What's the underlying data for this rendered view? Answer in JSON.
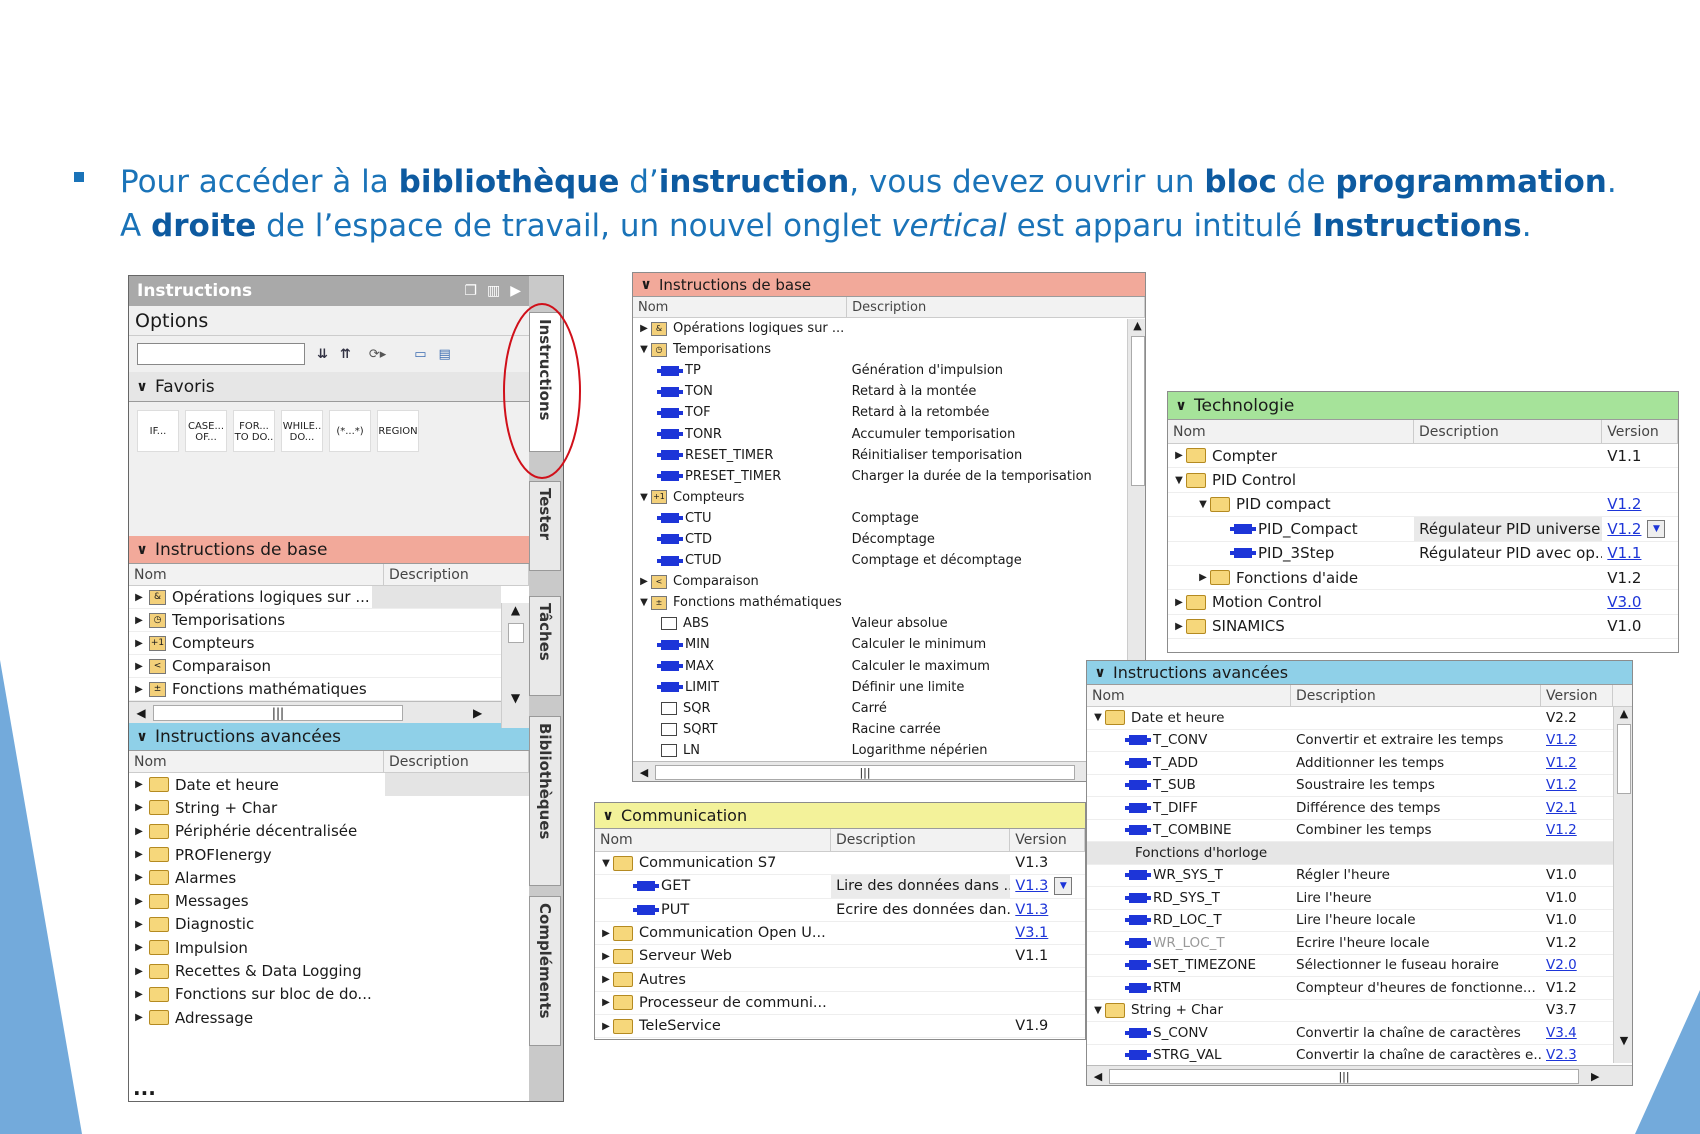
{
  "intro": {
    "line1_parts": [
      "Pour accéder à la ",
      "bibliothèque",
      " d’",
      "instruction",
      ", vous devez ouvrir un ",
      "bloc",
      " de ",
      "programmation",
      "."
    ],
    "line2_parts": [
      "A ",
      "droite",
      " de l’espace de travail, un nouvel onglet ",
      "vertical",
      " est apparu intitulé ",
      "Instructions",
      "."
    ]
  },
  "left_panel": {
    "title": "Instructions",
    "options": "Options",
    "favoris": "Favoris",
    "favorites": [
      "IF...",
      "CASE... OF...",
      "FOR... TO DO..",
      "WHILE.. DO...",
      "(*...*)",
      "REGION"
    ],
    "base": {
      "title": "Instructions de base",
      "col_name": "Nom",
      "col_desc": "Description",
      "items": [
        "Opérations logiques sur ...",
        "Temporisations",
        "Compteurs",
        "Comparaison",
        "Fonctions mathématiques"
      ]
    },
    "advanced": {
      "title": "Instructions avancées",
      "col_name": "Nom",
      "col_desc": "Description",
      "items": [
        "Date et heure",
        "String + Char",
        "Périphérie décentralisée",
        "PROFIenergy",
        "Alarmes",
        "Messages",
        "Diagnostic",
        "Impulsion",
        "Recettes & Data Logging",
        "Fonctions sur bloc de do...",
        "Adressage"
      ]
    },
    "ellipsis": "...",
    "vertical_tabs": [
      "Instructions",
      "Tester",
      "Tâches",
      "Bibliothèques",
      "Compléments"
    ]
  },
  "base_panel": {
    "title": "Instructions de base",
    "col_name": "Nom",
    "col_desc": "Description",
    "rows": [
      {
        "name": "Opérations logiques sur ...",
        "desc": ""
      },
      {
        "name": "Temporisations",
        "desc": ""
      },
      {
        "name": "TP",
        "desc": "Génération d'impulsion"
      },
      {
        "name": "TON",
        "desc": "Retard à la montée"
      },
      {
        "name": "TOF",
        "desc": "Retard à la retombée"
      },
      {
        "name": "TONR",
        "desc": "Accumuler temporisation"
      },
      {
        "name": "RESET_TIMER",
        "desc": "Réinitialiser temporisation"
      },
      {
        "name": "PRESET_TIMER",
        "desc": "Charger la durée de la temporisation"
      },
      {
        "name": "Compteurs",
        "desc": ""
      },
      {
        "name": "CTU",
        "desc": "Comptage"
      },
      {
        "name": "CTD",
        "desc": "Décomptage"
      },
      {
        "name": "CTUD",
        "desc": "Comptage et décomptage"
      },
      {
        "name": "Comparaison",
        "desc": ""
      },
      {
        "name": "Fonctions mathématiques",
        "desc": ""
      },
      {
        "name": "ABS",
        "desc": "Valeur absolue"
      },
      {
        "name": "MIN",
        "desc": "Calculer le minimum"
      },
      {
        "name": "MAX",
        "desc": "Calculer le maximum"
      },
      {
        "name": "LIMIT",
        "desc": "Définir une limite"
      },
      {
        "name": "SQR",
        "desc": "Carré"
      },
      {
        "name": "SQRT",
        "desc": "Racine carrée"
      },
      {
        "name": "LN",
        "desc": "Logarithme népérien"
      }
    ]
  },
  "tech_panel": {
    "title": "Technologie",
    "col_name": "Nom",
    "col_desc": "Description",
    "col_ver": "Version",
    "rows": [
      {
        "name": "Compter",
        "desc": "",
        "ver": "V1.1"
      },
      {
        "name": "PID Control",
        "desc": "",
        "ver": ""
      },
      {
        "name": "PID compact",
        "desc": "",
        "ver": "V1.2"
      },
      {
        "name": "PID_Compact",
        "desc": "Régulateur PID universe...",
        "ver": "V1.2"
      },
      {
        "name": "PID_3Step",
        "desc": "Régulateur PID avec op...",
        "ver": "V1.1"
      },
      {
        "name": "Fonctions d'aide",
        "desc": "",
        "ver": "V1.2"
      },
      {
        "name": "Motion Control",
        "desc": "",
        "ver": "V3.0"
      },
      {
        "name": "SINAMICS",
        "desc": "",
        "ver": "V1.0"
      }
    ]
  },
  "comm_panel": {
    "title": "Communication",
    "col_name": "Nom",
    "col_desc": "Description",
    "col_ver": "Version",
    "rows": [
      {
        "name": "Communication S7",
        "desc": "",
        "ver": "V1.3"
      },
      {
        "name": "GET",
        "desc": "Lire des données dans ...",
        "ver": "V1.3"
      },
      {
        "name": "PUT",
        "desc": "Ecrire des données dan...",
        "ver": "V1.3"
      },
      {
        "name": "Communication Open U...",
        "desc": "",
        "ver": "V3.1"
      },
      {
        "name": "Serveur Web",
        "desc": "",
        "ver": "V1.1"
      },
      {
        "name": "Autres",
        "desc": "",
        "ver": ""
      },
      {
        "name": "Processeur de communi...",
        "desc": "",
        "ver": ""
      },
      {
        "name": "TeleService",
        "desc": "",
        "ver": "V1.9"
      }
    ]
  },
  "adv_panel": {
    "title": "Instructions avancées",
    "col_name": "Nom",
    "col_desc": "Description",
    "col_ver": "Version",
    "rows": [
      {
        "name": "Date et heure",
        "desc": "",
        "ver": "V2.2"
      },
      {
        "name": "T_CONV",
        "desc": "Convertir et extraire les temps",
        "ver": "V1.2"
      },
      {
        "name": "T_ADD",
        "desc": "Additionner les temps",
        "ver": "V1.2"
      },
      {
        "name": "T_SUB",
        "desc": "Soustraire les temps",
        "ver": "V1.2"
      },
      {
        "name": "T_DIFF",
        "desc": "Différence des temps",
        "ver": "V2.1"
      },
      {
        "name": "T_COMBINE",
        "desc": "Combiner les temps",
        "ver": "V1.2"
      },
      {
        "name": "Fonctions d'horloge",
        "desc": "",
        "ver": ""
      },
      {
        "name": "WR_SYS_T",
        "desc": "Régler l'heure",
        "ver": "V1.0"
      },
      {
        "name": "RD_SYS_T",
        "desc": "Lire l'heure",
        "ver": "V1.0"
      },
      {
        "name": "RD_LOC_T",
        "desc": "Lire l'heure locale",
        "ver": "V1.0"
      },
      {
        "name": "WR_LOC_T",
        "desc": "Ecrire l'heure locale",
        "ver": "V1.2"
      },
      {
        "name": "SET_TIMEZONE",
        "desc": "Sélectionner le fuseau horaire",
        "ver": "V2.0"
      },
      {
        "name": "RTM",
        "desc": "Compteur d'heures de fonctionne...",
        "ver": "V1.2"
      },
      {
        "name": "String + Char",
        "desc": "",
        "ver": "V3.7"
      },
      {
        "name": "S_CONV",
        "desc": "Convertir la chaîne de caractères",
        "ver": "V3.4"
      },
      {
        "name": "STRG_VAL",
        "desc": "Convertir la chaîne de caractères e...",
        "ver": "V2.3"
      }
    ]
  },
  "colors": {
    "text_blue": "#1a73b8",
    "base_header": "#f2a99a",
    "adv_header": "#8fd0e8",
    "tech_header": "#a6e39a",
    "comm_header": "#f3f29a",
    "annotation_red": "#d0101a"
  }
}
